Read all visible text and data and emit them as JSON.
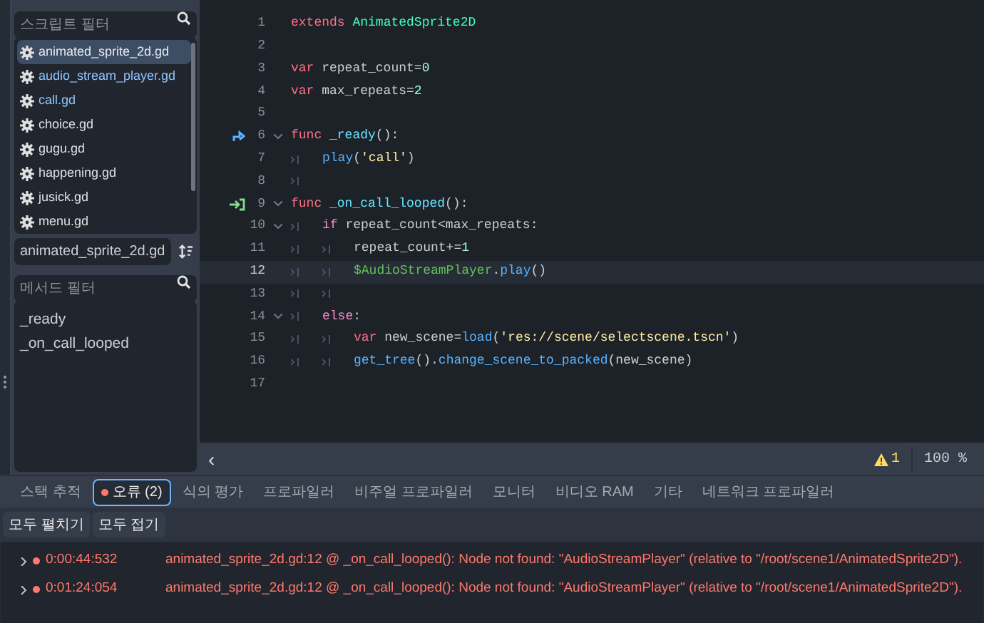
{
  "script_panel": {
    "filter": {
      "placeholder": "스크립트 필터"
    },
    "scripts": [
      {
        "name": "animated_sprite_2d.gd",
        "selected": true,
        "highlighted": true
      },
      {
        "name": "audio_stream_player.gd",
        "selected": false,
        "highlighted": true
      },
      {
        "name": "call.gd",
        "selected": false,
        "highlighted": true
      },
      {
        "name": "choice.gd",
        "selected": false,
        "highlighted": false
      },
      {
        "name": "gugu.gd",
        "selected": false,
        "highlighted": false
      },
      {
        "name": "happening.gd",
        "selected": false,
        "highlighted": false
      },
      {
        "name": "jusick.gd",
        "selected": false,
        "highlighted": false
      },
      {
        "name": "menu.gd",
        "selected": false,
        "highlighted": false
      }
    ],
    "current_script": "animated_sprite_2d.gd",
    "method_filter": {
      "placeholder": "메서드 필터"
    },
    "methods": [
      "_ready",
      "_on_call_looped"
    ]
  },
  "editor": {
    "lines": [
      {
        "number": "1",
        "kind": "plain",
        "foldable": false,
        "current": false,
        "tokens": [
          {
            "kind": "keyword",
            "text": "extends"
          },
          {
            "kind": "type",
            "text": " AnimatedSprite2D"
          }
        ]
      },
      {
        "number": "2",
        "kind": "plain",
        "foldable": false,
        "current": false
      },
      {
        "number": "3",
        "kind": "plain",
        "foldable": false,
        "current": false,
        "tokens": [
          {
            "kind": "keyword",
            "text": "var"
          },
          {
            "kind": "plain",
            "text": " repeat_count="
          },
          {
            "kind": "number",
            "text": "0"
          }
        ]
      },
      {
        "number": "4",
        "kind": "plain",
        "foldable": false,
        "current": false,
        "tokens": [
          {
            "kind": "keyword",
            "text": "var"
          },
          {
            "kind": "plain",
            "text": " max_repeats="
          },
          {
            "kind": "number",
            "text": "2"
          }
        ]
      },
      {
        "number": "5",
        "kind": "plain",
        "foldable": false,
        "current": false
      },
      {
        "number": "6",
        "kind": "override",
        "foldable": true,
        "current": false,
        "tokens": [
          {
            "kind": "keyword",
            "text": "func"
          },
          {
            "kind": "function",
            "text": " _ready"
          },
          {
            "kind": "plain",
            "text": "():"
          }
        ]
      },
      {
        "number": "7",
        "kind": "plain",
        "foldable": false,
        "current": false,
        "tokens": [
          {
            "kind": "tab"
          },
          {
            "kind": "call",
            "text": "play"
          },
          {
            "kind": "plain",
            "text": "("
          },
          {
            "kind": "string",
            "text": "'call'"
          },
          {
            "kind": "plain",
            "text": ")"
          }
        ]
      },
      {
        "number": "8",
        "kind": "plain",
        "foldable": false,
        "current": false,
        "tokens": [
          {
            "kind": "tab"
          }
        ]
      },
      {
        "number": "9",
        "kind": "signal",
        "foldable": true,
        "current": false,
        "tokens": [
          {
            "kind": "keyword",
            "text": "func"
          },
          {
            "kind": "function",
            "text": " _on_call_looped"
          },
          {
            "kind": "plain",
            "text": "():"
          }
        ]
      },
      {
        "number": "10",
        "kind": "plain",
        "foldable": true,
        "current": false,
        "tokens": [
          {
            "kind": "tab"
          },
          {
            "kind": "control",
            "text": "if"
          },
          {
            "kind": "plain",
            "text": " repeat_count<max_repeats:"
          }
        ]
      },
      {
        "number": "11",
        "kind": "plain",
        "foldable": false,
        "current": false,
        "tokens": [
          {
            "kind": "tab"
          },
          {
            "kind": "tab"
          },
          {
            "kind": "plain",
            "text": "repeat_count+="
          },
          {
            "kind": "number",
            "text": "1"
          }
        ]
      },
      {
        "number": "12",
        "kind": "plain",
        "foldable": false,
        "current": true,
        "tokens": [
          {
            "kind": "tab"
          },
          {
            "kind": "tab"
          },
          {
            "kind": "node",
            "text": "$AudioStreamPlayer"
          },
          {
            "kind": "plain",
            "text": "."
          },
          {
            "kind": "call",
            "text": "play"
          },
          {
            "kind": "plain",
            "text": "()"
          }
        ]
      },
      {
        "number": "13",
        "kind": "plain",
        "foldable": false,
        "current": false,
        "tokens": [
          {
            "kind": "tab"
          },
          {
            "kind": "tab"
          }
        ]
      },
      {
        "number": "14",
        "kind": "plain",
        "foldable": true,
        "current": false,
        "tokens": [
          {
            "kind": "tab"
          },
          {
            "kind": "control",
            "text": "else"
          },
          {
            "kind": "plain",
            "text": ":"
          }
        ]
      },
      {
        "number": "15",
        "kind": "plain",
        "foldable": false,
        "current": false,
        "tokens": [
          {
            "kind": "tab"
          },
          {
            "kind": "tab"
          },
          {
            "kind": "keyword",
            "text": "var"
          },
          {
            "kind": "plain",
            "text": " new_scene="
          },
          {
            "kind": "call",
            "text": "load"
          },
          {
            "kind": "plain",
            "text": "("
          },
          {
            "kind": "string",
            "text": "'res://scene/selectscene.tscn'"
          },
          {
            "kind": "plain",
            "text": ")"
          }
        ]
      },
      {
        "number": "16",
        "kind": "plain",
        "foldable": false,
        "current": false,
        "tokens": [
          {
            "kind": "tab"
          },
          {
            "kind": "tab"
          },
          {
            "kind": "call",
            "text": "get_tree"
          },
          {
            "kind": "plain",
            "text": "()."
          },
          {
            "kind": "call",
            "text": "change_scene_to_packed"
          },
          {
            "kind": "plain",
            "text": "(new_scene)"
          }
        ]
      },
      {
        "number": "17",
        "kind": "plain",
        "foldable": false,
        "current": false
      }
    ]
  },
  "status_bar": {
    "back": "‹",
    "warnings": "1",
    "zoom": "100 %"
  },
  "bottom_panel": {
    "tabs": [
      {
        "label": "스택 추적",
        "selected": false,
        "error_dot": false
      },
      {
        "label": "오류 (2)",
        "selected": true,
        "error_dot": true
      },
      {
        "label": "식의 평가",
        "selected": false,
        "error_dot": false
      },
      {
        "label": "프로파일러",
        "selected": false,
        "error_dot": false
      },
      {
        "label": "비주얼 프로파일러",
        "selected": false,
        "error_dot": false
      },
      {
        "label": "모니터",
        "selected": false,
        "error_dot": false
      },
      {
        "label": "비디오 RAM",
        "selected": false,
        "error_dot": false
      },
      {
        "label": "기타",
        "selected": false,
        "error_dot": false
      },
      {
        "label": "네트워크 프로파일러",
        "selected": false,
        "error_dot": false
      }
    ],
    "buttons": [
      "모두 펼치기",
      "모두 접기"
    ],
    "errors": [
      {
        "expanded": false,
        "time": "0:00:44:532",
        "message": "animated_sprite_2d.gd:12 @ _on_call_looped(): Node not found: \"AudioStreamPlayer\" (relative to \"/root/scene1/AnimatedSprite2D\")."
      },
      {
        "expanded": false,
        "time": "0:01:24:054",
        "message": "animated_sprite_2d.gd:12 @ _on_call_looped(): Node not found: \"AudioStreamPlayer\" (relative to \"/root/scene1/AnimatedSprite2D\")."
      }
    ]
  }
}
